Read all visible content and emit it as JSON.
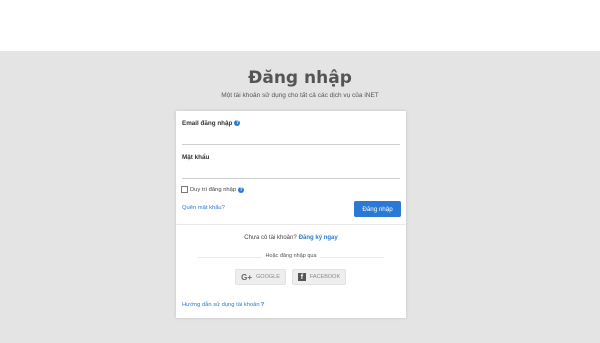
{
  "page": {
    "title": "Đăng nhập",
    "subtitle": "Một tài khoản sử dụng cho tất cả các dịch vụ của iNET"
  },
  "form": {
    "email_label": "Email đăng nhập",
    "email_value": "",
    "password_label": "Mật khẩu",
    "password_value": "",
    "remember_label": "Duy trì đăng nhập",
    "remember_checked": false,
    "forgot_label": "Quên mật khẩu?",
    "submit_label": "Đăng nhập"
  },
  "signup": {
    "prompt": "Chưa có tài khoản?",
    "link_label": "Đăng ký ngay"
  },
  "social": {
    "divider_text": "Hoặc đăng nhập qua",
    "google_label": "GOOGLE",
    "facebook_label": "FACEBOOK"
  },
  "help": {
    "guide_label": "Hướng dẫn sử dụng tài khoản",
    "guide_suffix": "?"
  },
  "colors": {
    "accent": "#2a7ad5",
    "background": "#e4e4e4",
    "title": "#555555"
  },
  "icons": [
    "help-icon",
    "google-icon",
    "facebook-icon",
    "question-icon"
  ]
}
